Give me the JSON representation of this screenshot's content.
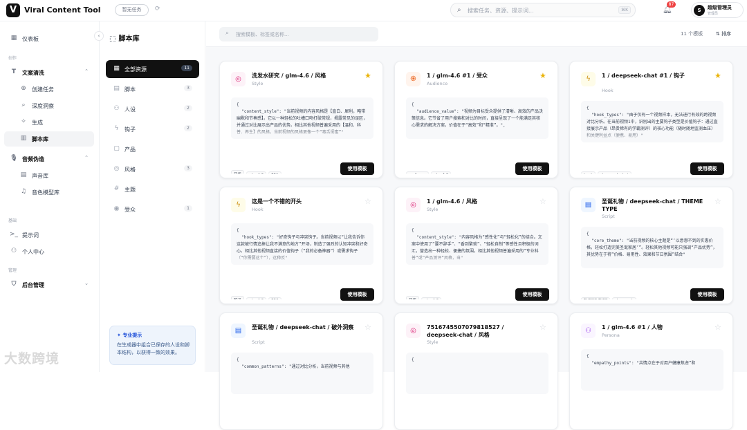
{
  "header": {
    "logo_letter": "V",
    "app_title": "Viral Content Tool",
    "task_pill": "暂无任务",
    "search_placeholder": "搜索任务、资源、提示词...",
    "search_shortcut": "⌘K",
    "notification_count": "87",
    "user_initial": "S",
    "user_name": "超级管理员",
    "user_role": "管理员"
  },
  "sidebar": {
    "dashboard": "仪表板",
    "section_create": "创作",
    "copy_cleaning": "文案清洗",
    "create_task": "创建任务",
    "deep_insight": "深度洞察",
    "generate": "生成",
    "script_library": "脚本库",
    "audio_forge": "音频伪造",
    "voice_library": "声音库",
    "voice_model_library": "音色模型库",
    "section_tools": "基础",
    "prompts": "提示词",
    "personal_center": "个人中心",
    "section_manage": "管理",
    "admin": "后台管理"
  },
  "library": {
    "title": "脚本库",
    "categories": [
      {
        "label": "全部资源",
        "count": "11",
        "icon": "grid-icon"
      },
      {
        "label": "脚本",
        "count": "3",
        "icon": "document-icon"
      },
      {
        "label": "人设",
        "count": "2",
        "icon": "user-icon"
      },
      {
        "label": "钩子",
        "count": "2",
        "icon": "lightning-icon"
      },
      {
        "label": "产品",
        "count": "",
        "icon": "box-icon"
      },
      {
        "label": "风格",
        "count": "3",
        "icon": "palette-icon"
      },
      {
        "label": "主题",
        "count": "",
        "icon": "hash-icon"
      },
      {
        "label": "受众",
        "count": "1",
        "icon": "target-icon"
      }
    ],
    "tip_title": "专业提示",
    "tip_body": "在生成器中组合已保存的人设和脚本结构，以获得一致的效果。"
  },
  "main": {
    "search_placeholder": "搜索模板、标签或名称...",
    "template_count": "11 个模板",
    "sort_label": "排序",
    "use_label": "使用模板"
  },
  "cards": [
    {
      "title": "洗发水研究 / glm-4.6 / 风格",
      "type": "Style",
      "starred": true,
      "icon": "palette-icon",
      "code": "{\n  \"content_style\": \"当前视频的内容风格是【直白、犀利，略带幽默和节奏感】。它以一种轻松的吐槽口吻打破常规，揭露常见的误区，并通过对比展示出产品的优势。相比其他视频普遍采用的【温和、科普、养生】的风格，当前视频的风格更像一个“毒舌闺蜜”\"",
      "tags": [
        "风格",
        "glm-4.6",
        "751"
      ]
    },
    {
      "title": "1 / glm-4.6 #1 / 受众",
      "type": "Audience",
      "starred": true,
      "icon": "fingerprint-icon",
      "code": "{\n  \"audience_value\": \"视频为目标受众提供了清晰、高效的产品决策信息。它节省了用户搜索和对比的时间，直接呈现了一个能满足其核心需求的解决方案，价值在于“高效”和“精准”。\",",
      "tags": [
        "audience",
        "glm-4.6"
      ]
    },
    {
      "title": "1 / deepseek-chat #1 / 钩子",
      "type": "Hook",
      "starred": true,
      "icon": "lightning-icon",
      "code": "{\n  \"hook_types\": \"由于仅有一个视频样本，无法进行有效的跨视频对比分析。在当前视频1中，识别出的主要钩子类型是价值钩子：通过直接展示产品（昂贵稀有的学霸测评）的核心功能（随时随地监测血压）和关键利益点（便携、易用）\"",
      "tags": [
        "hook",
        "deepseek-chat"
      ]
    },
    {
      "title": "这是一个不错的开头",
      "type": "Hook",
      "starred": false,
      "icon": "lightning-icon",
      "code": "{\n  \"hook_types\": \"好奇钩子与冲突钩子。当前视频以“让我告诉你这款被行情追捧让我不满意的地方”开场，制造了强烈的认知冲突和好奇心。相比其他视频直接的价值钩子（“我的必备神器”）或需求钩子（“你需要这个”），这种反\"",
      "tags": [
        "钩子",
        "glm-4.6",
        "756"
      ]
    },
    {
      "title": "1 / glm-4.6 / 风格",
      "type": "Style",
      "starred": false,
      "icon": "palette-icon",
      "code": "{\n  \"content_style\": \"内容风格为“感性化”与“轻松化”的结合。文案中使用了“要不辞手”、“香到繁琐”、“轻松自制”等感性且积极的词汇，营造出一种轻松、便捷的氛围。相比其他视频普遍采用的“专业科普”或“产品测评”风格，当\"",
      "tags": [
        "风格",
        "glm-4.6"
      ]
    },
    {
      "title": "圣诞礼物 / deepseek-chat / THEME TYPE",
      "type": "Script",
      "starred": false,
      "icon": "document-icon",
      "code": "{\n  \"core_theme\": \"当前视频的核心主题是“‘以意想不到的实惠价格，轻松打造完美圣诞家居’”。轻松其他视频可能只强调“产品优势”，其优势在于将“价格、易用性、效果和节日氛围”结合\"",
      "tags": [
        "THEME TYPE",
        "deepseek"
      ]
    },
    {
      "title": "圣诞礼物 / deepseek-chat / 破外洞察",
      "type": "Script",
      "starred": false,
      "icon": "document-icon",
      "code": "{\n  \"common_patterns\": \"通过对比分析，当前视频与其他",
      "tags": []
    },
    {
      "title": "7516745507079818527 / deepseek-chat / 风格",
      "type": "Style",
      "starred": false,
      "icon": "palette-icon",
      "code": "{",
      "tags": []
    },
    {
      "title": "1 / glm-4.6 #1 / 人物",
      "type": "Persona",
      "starred": false,
      "icon": "user-icon",
      "code": "{\n  \"empathy_points\": \"共情点在于对用户健康焦虑”和",
      "tags": []
    }
  ],
  "watermark": "大数跨境"
}
